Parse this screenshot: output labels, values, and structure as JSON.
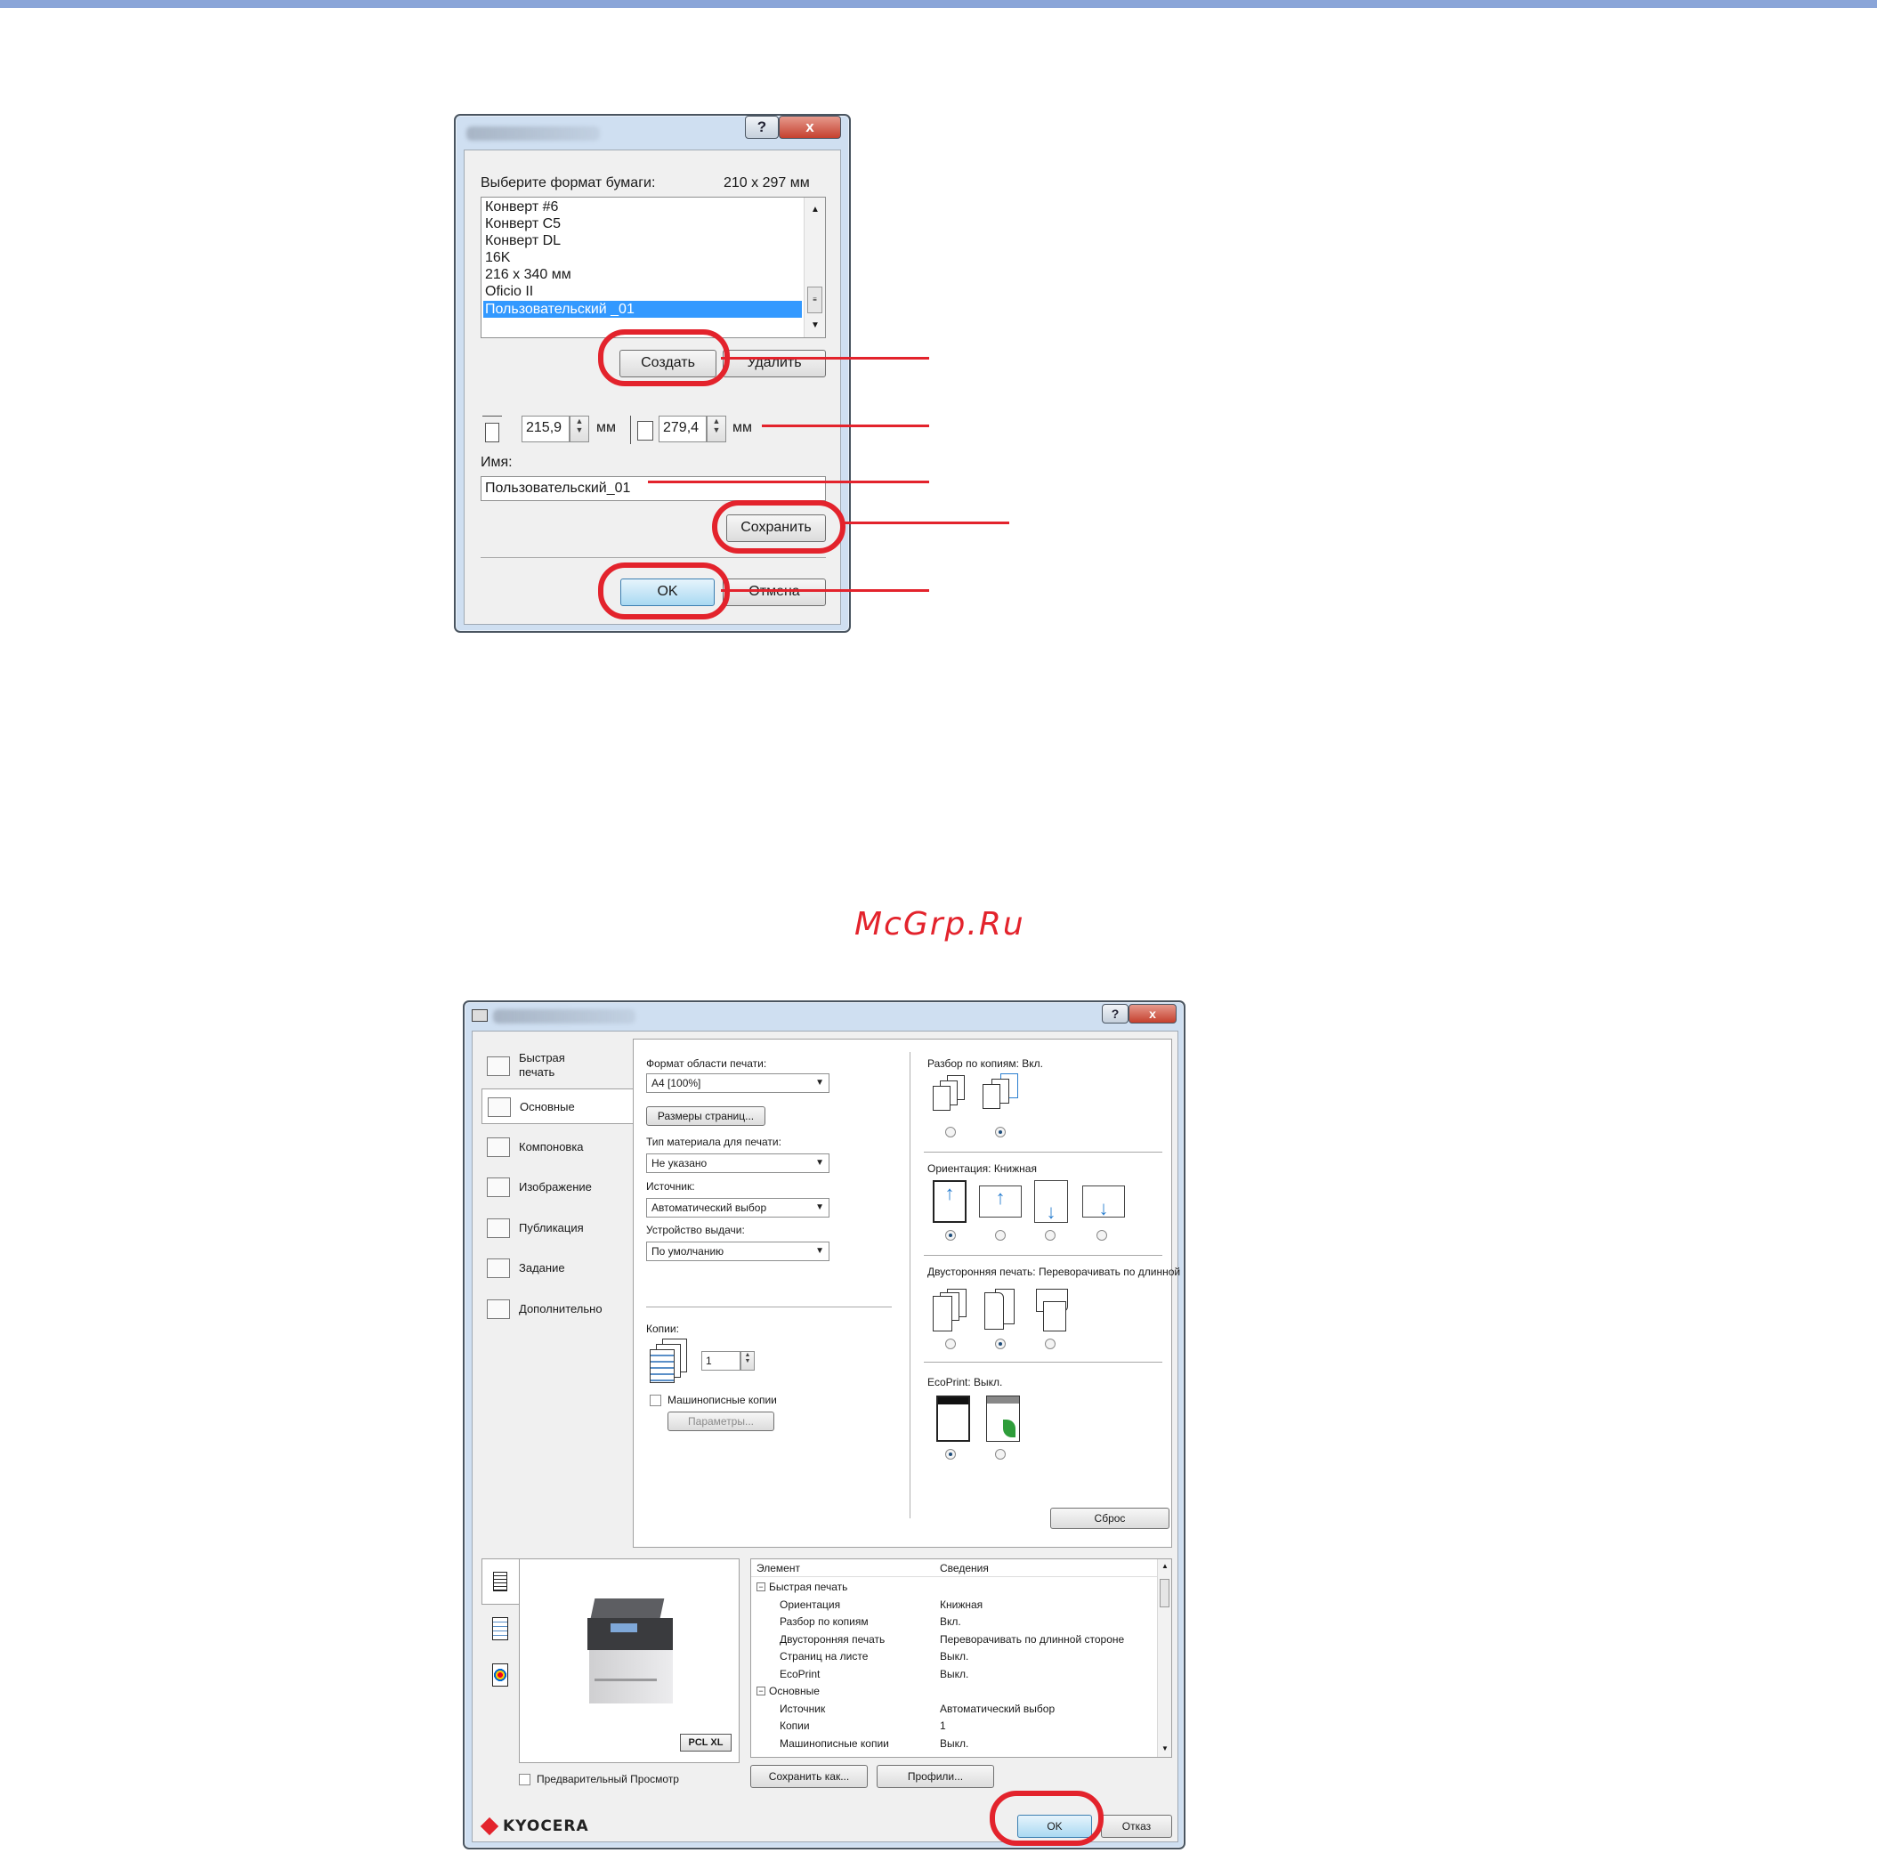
{
  "watermark": "McGrp.Ru",
  "paper_dialog": {
    "help_glyph": "?",
    "close_glyph": "x",
    "select_label": "Выберите формат бумаги:",
    "size_readout": "210 x 297 мм",
    "list_items": [
      "Конверт #6",
      "Конверт C5",
      "Конверт DL",
      "16K",
      "216 x 340 мм",
      "Oficio II",
      "Пользовательский _01"
    ],
    "selected_item": "Пользовательский _01",
    "create_button": "Создать",
    "delete_button": "Удалить",
    "width_value": "215,9",
    "height_value": "279,4",
    "unit_1": "мм",
    "unit_2": "мм",
    "name_label": "Имя:",
    "name_value": "Пользовательский_01",
    "save_button": "Сохранить",
    "ok_button": "OK",
    "cancel_button": "Отмена"
  },
  "print_dialog": {
    "help_glyph": "?",
    "close_glyph": "x",
    "tabs": [
      "Быстрая печать",
      "Основные",
      "Компоновка",
      "Изображение",
      "Публикация",
      "Задание",
      "Дополнительно"
    ],
    "selected_tab": "Основные",
    "print_size_label": "Формат области печати:",
    "print_size_value": "A4 [100%]",
    "page_sizes_button": "Размеры страниц...",
    "media_type_label": "Тип материала для печати:",
    "media_type_value": "Не указано",
    "source_label": "Источник:",
    "source_value": "Автоматический выбор",
    "output_label": "Устройство выдачи:",
    "output_value": "По умолчанию",
    "copies_label": "Копии:",
    "copies_value": "1",
    "collate_checkbox_label": "Машинописные копии",
    "params_button": "Параметры...",
    "collate_label": "Разбор по копиям:",
    "collate_value": "Вкл.",
    "orientation_label": "Ориентация:",
    "orientation_value": "Книжная",
    "duplex_label": "Двусторонняя печать:",
    "duplex_value": "Переворачивать по длинной",
    "ecoprint_label": "EcoPrint:",
    "ecoprint_value": "Выкл.",
    "reset_button": "Сброс",
    "pcl_badge": "PCL XL",
    "preview_checkbox_label": "Предварительный Просмотр",
    "summary_headers": [
      "Элемент",
      "Сведения"
    ],
    "summary_rows": [
      {
        "element": "Быстрая печать",
        "value": "",
        "group": true
      },
      {
        "element": "Ориентация",
        "value": "Книжная",
        "group": false
      },
      {
        "element": "Разбор по копиям",
        "value": "Вкл.",
        "group": false
      },
      {
        "element": "Двусторонняя печать",
        "value": "Переворачивать по длинной стороне",
        "group": false
      },
      {
        "element": "Страниц на листе",
        "value": "Выкл.",
        "group": false
      },
      {
        "element": "EcoPrint",
        "value": "Выкл.",
        "group": false
      },
      {
        "element": "Основные",
        "value": "",
        "group": true
      },
      {
        "element": "Источник",
        "value": "Автоматический выбор",
        "group": false
      },
      {
        "element": "Копии",
        "value": "1",
        "group": false
      },
      {
        "element": "Машинописные копии",
        "value": "Выкл.",
        "group": false
      }
    ],
    "save_as_button": "Сохранить как...",
    "profiles_button": "Профили...",
    "brand": "KYOCERA",
    "ok_button": "OK",
    "cancel_button": "Отказ"
  },
  "annotation_color": "#e3232c"
}
